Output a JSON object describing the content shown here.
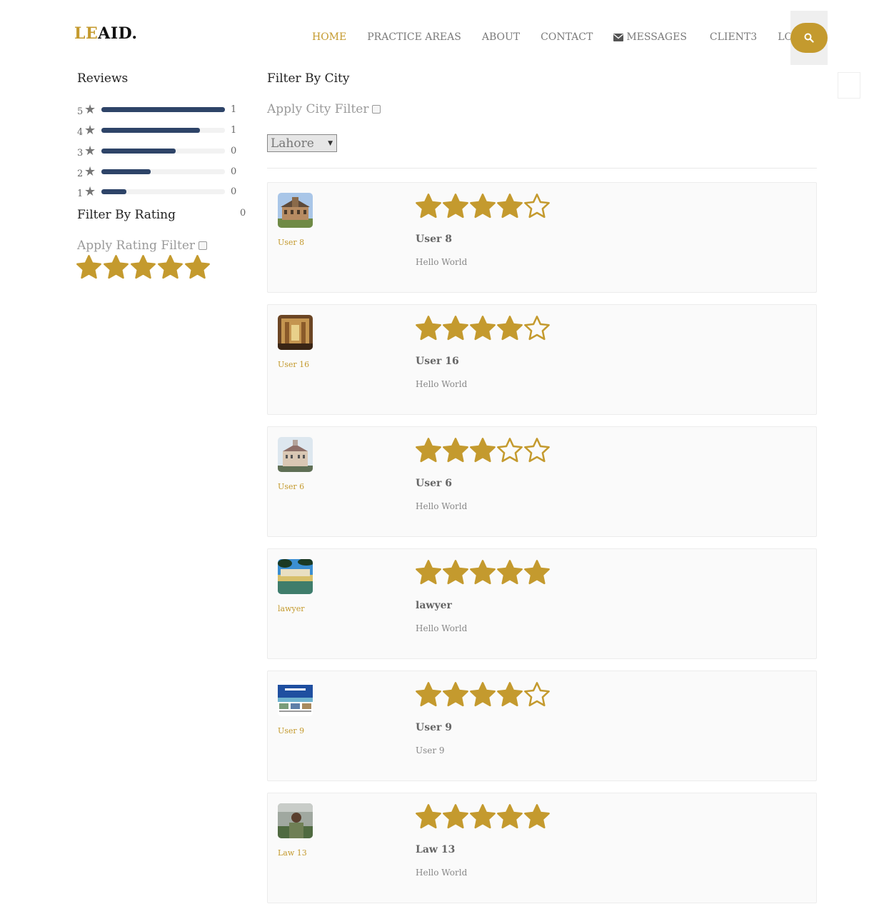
{
  "brand": {
    "part1": "LE",
    "part2": "AID."
  },
  "nav": [
    {
      "label": "HOME",
      "active": true
    },
    {
      "label": "PRACTICE AREAS"
    },
    {
      "label": "ABOUT"
    },
    {
      "label": "CONTACT"
    },
    {
      "label": "MESSAGES",
      "icon": "envelope-icon"
    },
    {
      "label": "CLIENT3"
    },
    {
      "label": "LOGOUT"
    }
  ],
  "search": {
    "icon": "search-icon"
  },
  "reviews": {
    "title": "Reviews",
    "rows": [
      {
        "stars": "5",
        "count": "1",
        "fill": 1.0
      },
      {
        "stars": "4",
        "count": "1",
        "fill": 0.8
      },
      {
        "stars": "3",
        "count": "0",
        "fill": 0.6
      },
      {
        "stars": "2",
        "count": "0",
        "fill": 0.4
      },
      {
        "stars": "1",
        "count": "0",
        "fill": 0.2
      }
    ],
    "extra_count": "0"
  },
  "rating_filter": {
    "title": "Filter By Rating",
    "apply_label": "Apply Rating Filter",
    "checked": false,
    "selected_stars": 5
  },
  "city_filter": {
    "title": "Filter By City",
    "apply_label": "Apply City Filter",
    "checked": false,
    "selected_city": "Lahore"
  },
  "review_list": [
    {
      "name": "User 8",
      "rating": 4,
      "comment": "Hello World",
      "avatar": "palace"
    },
    {
      "name": "User 16",
      "rating": 4,
      "comment": "Hello World",
      "avatar": "hall"
    },
    {
      "name": "User 6",
      "rating": 3,
      "comment": "Hello World",
      "avatar": "building"
    },
    {
      "name": "lawyer",
      "rating": 5,
      "comment": "Hello World",
      "avatar": "lake"
    },
    {
      "name": "User 9",
      "rating": 4,
      "comment": "User 9",
      "avatar": "website"
    },
    {
      "name": "Law 13",
      "rating": 5,
      "comment": "Hello World",
      "avatar": "person"
    }
  ],
  "colors": {
    "accent": "#c49a2e",
    "bar": "#2e4468"
  }
}
